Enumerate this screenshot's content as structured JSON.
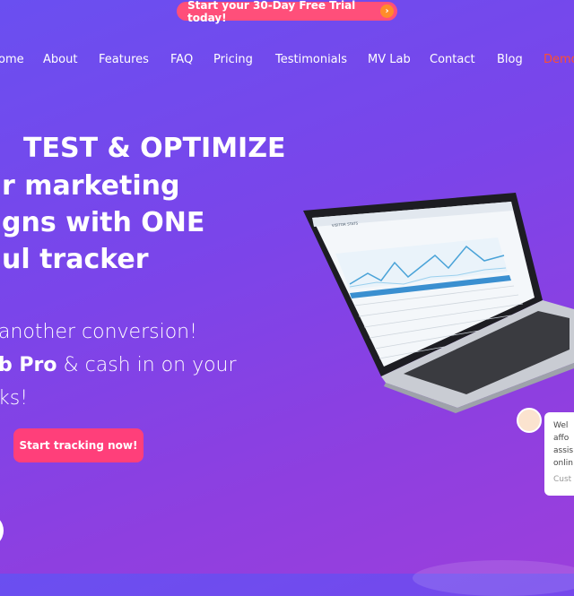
{
  "promo": {
    "label": "Start your 30-Day Free Trial today!",
    "icon": "chevron-right-icon"
  },
  "nav": {
    "items": [
      "ome",
      "About",
      "Features",
      "FAQ",
      "Pricing",
      "Testimonials",
      "MV Lab",
      "Contact",
      "Blog",
      "Demo"
    ]
  },
  "hero": {
    "heading": [
      "TEST & OPTIMIZE",
      "r marketing",
      "gns with ONE",
      "ul tracker"
    ],
    "sub_1": "another conversion!",
    "sub_2_bold": "b Pro",
    "sub_2_rest": " & cash in on your",
    "sub_3": "ks!",
    "cta": "Start tracking now!"
  },
  "laptop": {
    "screen_title": "VISITOR STATS"
  },
  "chat": {
    "lines": [
      "Wel",
      "affo",
      "assis",
      "onlin"
    ],
    "muted": "Cust"
  },
  "colors": {
    "accent": "#ff4f7a",
    "demo": "#ff4f2e",
    "promo_arrow": "#ff8c2a"
  }
}
